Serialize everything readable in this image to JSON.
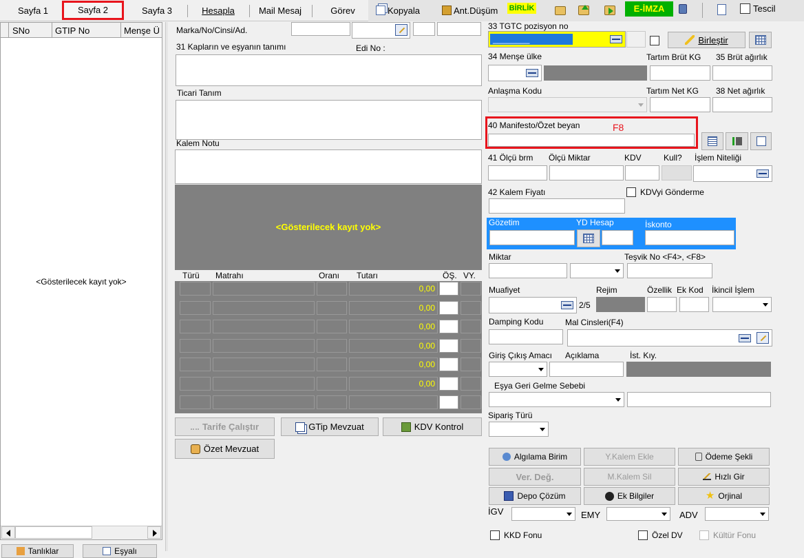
{
  "tabs": [
    {
      "label": "Sayfa 1"
    },
    {
      "label": "Sayfa 2"
    },
    {
      "label": "Sayfa 3"
    },
    {
      "label": "Hesapla"
    },
    {
      "label": "Mail Mesaj"
    },
    {
      "label": "Görev"
    }
  ],
  "toolbar": {
    "kopyala": "Kopyala",
    "ant_dusum": "Ant.Düşüm",
    "birlik": "BİRLİK",
    "e_imza": "E-İMZA",
    "tescil": "Tescil"
  },
  "left_grid": {
    "columns": [
      "SNo",
      "GTIP No",
      "Menşe Ü"
    ],
    "empty_text": "<Gösterilecek kayıt yok>"
  },
  "bottom_left_buttons": [
    "Tanlıklar",
    "Eşyalı"
  ],
  "middle": {
    "marka_label": "Marka/No/Cinsi/Ad.",
    "kaplar_label": "31 Kapların ve eşyanın tanımı",
    "edi_label": "Edi No :",
    "ticari_label": "Ticari Tanım",
    "kalem_notu_label": "Kalem Notu",
    "empty_text": "<Gösterilecek kayıt yok>",
    "tax_columns": [
      "Türü",
      "Matrahı",
      "Oranı",
      "Tutarı",
      "ÖŞ.",
      "VY."
    ],
    "tax_rows": [
      "0,00",
      "0,00",
      "0,00",
      "0,00",
      "0,00",
      "0,00",
      ""
    ],
    "btn_tarife": "Tarife Çalıştır",
    "btn_gtip": "GTip Mevzuat",
    "btn_kdv": "KDV Kontrol",
    "btn_ozet": "Özet Mevzuat"
  },
  "right": {
    "tgtc_label": "33 TGTC pozisyon no",
    "tgtc_value": "________",
    "birlestir": "Birleştir",
    "mense_label": "34 Menşe ülke",
    "tartim_brut_label": "Tartım Brüt KG",
    "brut_label": "35 Brüt ağırlık",
    "anlasma_label": "Anlaşma Kodu",
    "tartim_net_label": "Tartım Net KG",
    "net_label": "38 Net ağırlık",
    "manifesto_label": "40 Manifesto/Özet beyan",
    "annotation": "F8",
    "olcu_brm_label": "41 Ölçü brm",
    "olcu_miktar_label": "Ölçü Miktar",
    "kdv_label": "KDV",
    "kull_label": "Kull?",
    "islem_label": "İşlem Niteliği",
    "kalem_fiyati_label": "42 Kalem Fiyatı",
    "kdv_gonderme": "KDVyi Gönderme",
    "gozetim_label": "Gözetim",
    "yd_hesap_label": "YD Hesap",
    "iskonto_label": "İskonto",
    "miktar_label": "Miktar",
    "tesvik_label": "Teşvik No <F4>, <F8>",
    "muafiyet_label": "Muafiyet",
    "muafiyet_count": "2/5",
    "rejim_label": "Rejim",
    "ozellik_label": "Özellik",
    "ek_kod_label": "Ek Kod",
    "ikincil_label": "İkincil İşlem",
    "damping_label": "Damping Kodu",
    "mal_cinsleri_label": "Mal Cinsleri(F4)",
    "giris_label": "Giriş Çıkış Amacı",
    "aciklama_label": "Açıklama",
    "ist_kiy_label": "İst. Kıy.",
    "esya_label": "Eşya Geri Gelme Sebebi",
    "siparis_label": "Sipariş Türü",
    "btn_algilama": "Algılama Birim",
    "btn_ykalem": "Y.Kalem Ekle",
    "btn_odeme": "Ödeme Şekli",
    "btn_ver_deg": "Ver. Değ.",
    "btn_mkalem": "M.Kalem Sil",
    "btn_hizli": "Hızlı Gir",
    "btn_depo": "Depo Çözüm",
    "btn_ek": "Ek Bilgiler",
    "btn_orjinal": "Orjinal",
    "igv_label": "İGV",
    "emy_label": "EMY",
    "adv_label": "ADV",
    "kkd_label": "KKD Fonu",
    "ozel_dv_label": "Özel DV",
    "kultur_label": "Kültür Fonu"
  },
  "colors": {
    "highlight_red": "#e8141c",
    "yellow_field": "#ffff00",
    "blue_panel": "#1e90ff",
    "grid_gray": "#808080",
    "grid_value": "#ffff00",
    "birlik_green": "#00a000",
    "eimza_text": "#ffff00",
    "eimza_bg": "#00b000"
  }
}
